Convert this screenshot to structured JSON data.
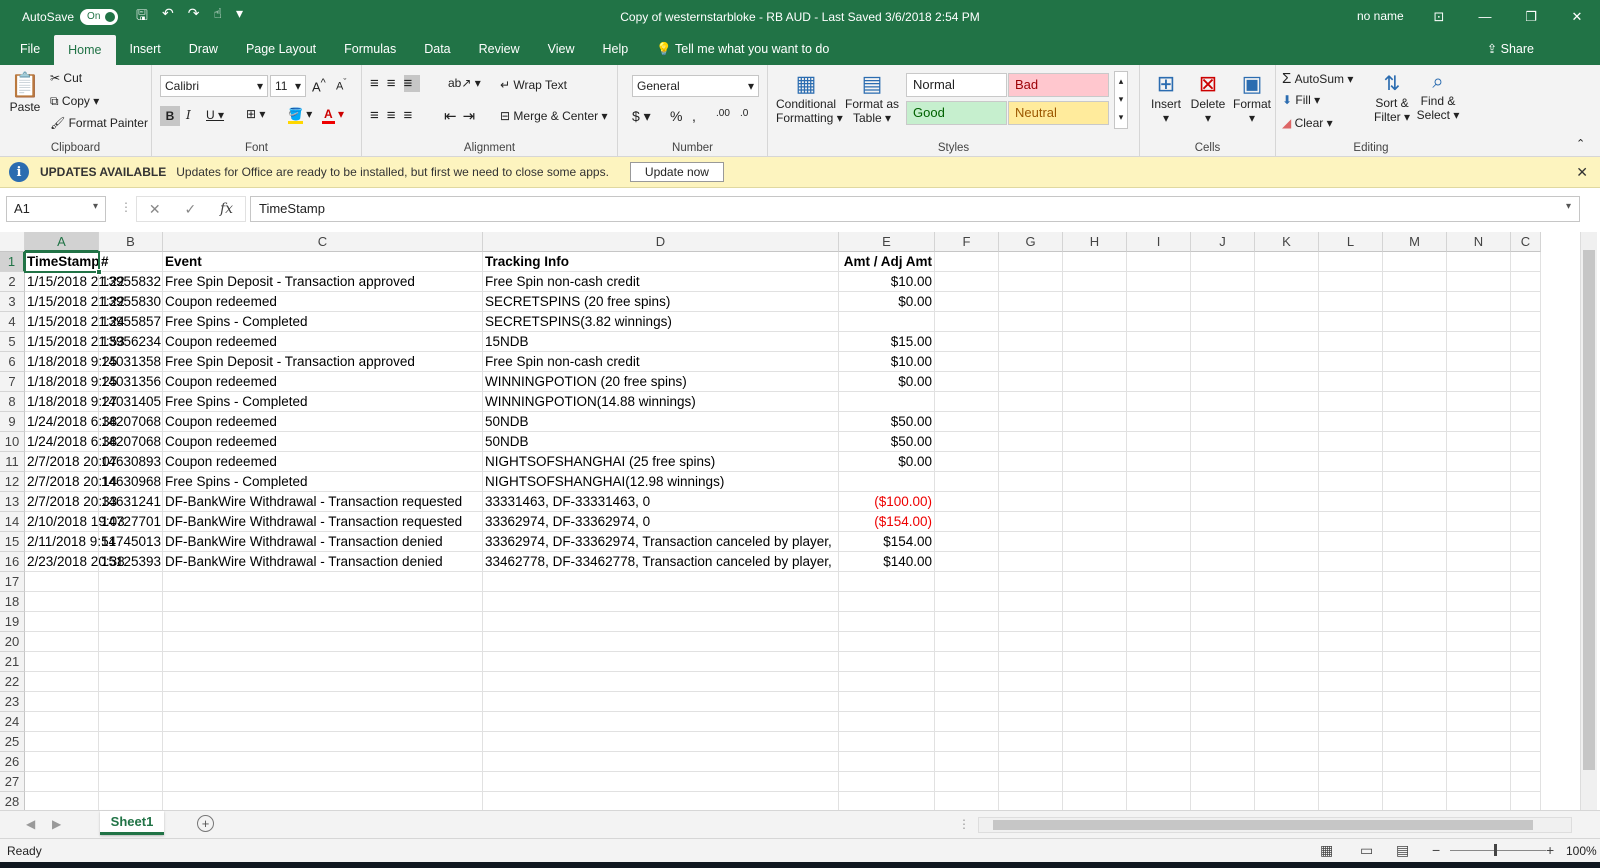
{
  "titlebar": {
    "autosave_label": "AutoSave",
    "autosave_state": "On",
    "document_title": "Copy of westernstarbloke - RB AUD  -  Last Saved 3/6/2018 2:54 PM",
    "user": "no name"
  },
  "tabs": [
    "File",
    "Home",
    "Insert",
    "Draw",
    "Page Layout",
    "Formulas",
    "Data",
    "Review",
    "View",
    "Help"
  ],
  "active_tab": "Home",
  "tell_me": "Tell me what you want to do",
  "share": "Share",
  "ribbon": {
    "clipboard": {
      "label": "Clipboard",
      "paste": "Paste",
      "cut": "Cut",
      "copy": "Copy",
      "format_painter": "Format Painter"
    },
    "font": {
      "label": "Font",
      "font_name": "Calibri",
      "font_size": "11"
    },
    "alignment": {
      "label": "Alignment",
      "wrap_text": "Wrap Text",
      "merge_center": "Merge & Center"
    },
    "number": {
      "label": "Number",
      "format": "General"
    },
    "styles": {
      "label": "Styles",
      "conditional": "Conditional",
      "conditional2": "Formatting",
      "format_as": "Format as",
      "format_as2": "Table",
      "normal": "Normal",
      "bad": "Bad",
      "good": "Good",
      "neutral": "Neutral"
    },
    "cells": {
      "label": "Cells",
      "insert": "Insert",
      "delete": "Delete",
      "format": "Format"
    },
    "editing": {
      "label": "Editing",
      "autosum": "AutoSum",
      "fill": "Fill",
      "clear": "Clear",
      "sort": "Sort &",
      "sort2": "Filter",
      "find": "Find &",
      "find2": "Select"
    }
  },
  "update_bar": {
    "title": "UPDATES AVAILABLE",
    "message": "Updates for Office are ready to be installed, but first we need to close some apps.",
    "button": "Update now"
  },
  "formula_bar": {
    "name_box": "A1",
    "content": "TimeStamp"
  },
  "columns": [
    "A",
    "B",
    "C",
    "D",
    "E",
    "F",
    "G",
    "H",
    "I",
    "J",
    "K",
    "L",
    "M",
    "N",
    "C"
  ],
  "row_count": 28,
  "headers": [
    "TimeStamp",
    "#",
    "Event",
    "Tracking Info",
    "Amt / Adj Amt"
  ],
  "rows": [
    [
      "1/15/2018 21:22",
      "13955832",
      "Free Spin Deposit - Transaction approved",
      "Free Spin non-cash credit",
      "$10.00"
    ],
    [
      "1/15/2018 21:22",
      "13955830",
      "Coupon redeemed",
      "SECRETSPINS (20 free spins)",
      "$0.00"
    ],
    [
      "1/15/2018 21:24",
      "13955857",
      "Free Spins - Completed",
      "SECRETSPINS(3.82 winnings)",
      ""
    ],
    [
      "1/15/2018 21:53",
      "13956234",
      "Coupon redeemed",
      "15NDB",
      "$15.00"
    ],
    [
      "1/18/2018 9:25",
      "14031358",
      "Free Spin Deposit - Transaction approved",
      "Free Spin non-cash credit",
      "$10.00"
    ],
    [
      "1/18/2018 9:25",
      "14031356",
      "Coupon redeemed",
      "WINNINGPOTION (20 free spins)",
      "$0.00"
    ],
    [
      "1/18/2018 9:27",
      "14031405",
      "Free Spins - Completed",
      "WINNINGPOTION(14.88 winnings)",
      ""
    ],
    [
      "1/24/2018 6:38",
      "14207068",
      "Coupon redeemed",
      "50NDB",
      "$50.00"
    ],
    [
      "1/24/2018 6:38",
      "14207068",
      "Coupon redeemed",
      "50NDB",
      "$50.00"
    ],
    [
      "2/7/2018 20:07",
      "14630893",
      "Coupon redeemed",
      "NIGHTSOFSHANGHAI (25 free spins)",
      "$0.00"
    ],
    [
      "2/7/2018 20:14",
      "14630968",
      "Free Spins - Completed",
      "NIGHTSOFSHANGHAI(12.98 winnings)",
      ""
    ],
    [
      "2/7/2018 20:33",
      "14631241",
      "DF-BankWire Withdrawal - Transaction requested",
      "33331463, DF-33331463, 0",
      "($100.00)"
    ],
    [
      "2/10/2018 19:03",
      "14727701",
      "DF-BankWire Withdrawal - Transaction requested",
      "33362974, DF-33362974, 0",
      "($154.00)"
    ],
    [
      "2/11/2018 9:51",
      "14745013",
      "DF-BankWire Withdrawal - Transaction denied",
      "33362974, DF-33362974, Transaction canceled by player,",
      "$154.00"
    ],
    [
      "2/23/2018 20:38",
      "15125393",
      "DF-BankWire Withdrawal - Transaction denied",
      "33462778, DF-33462778, Transaction canceled by player,",
      "$140.00"
    ]
  ],
  "sheet_tab": "Sheet1",
  "status": {
    "ready": "Ready",
    "zoom": "100%"
  },
  "colors": {
    "excel_green": "#217346",
    "negative": "#ee0000"
  }
}
